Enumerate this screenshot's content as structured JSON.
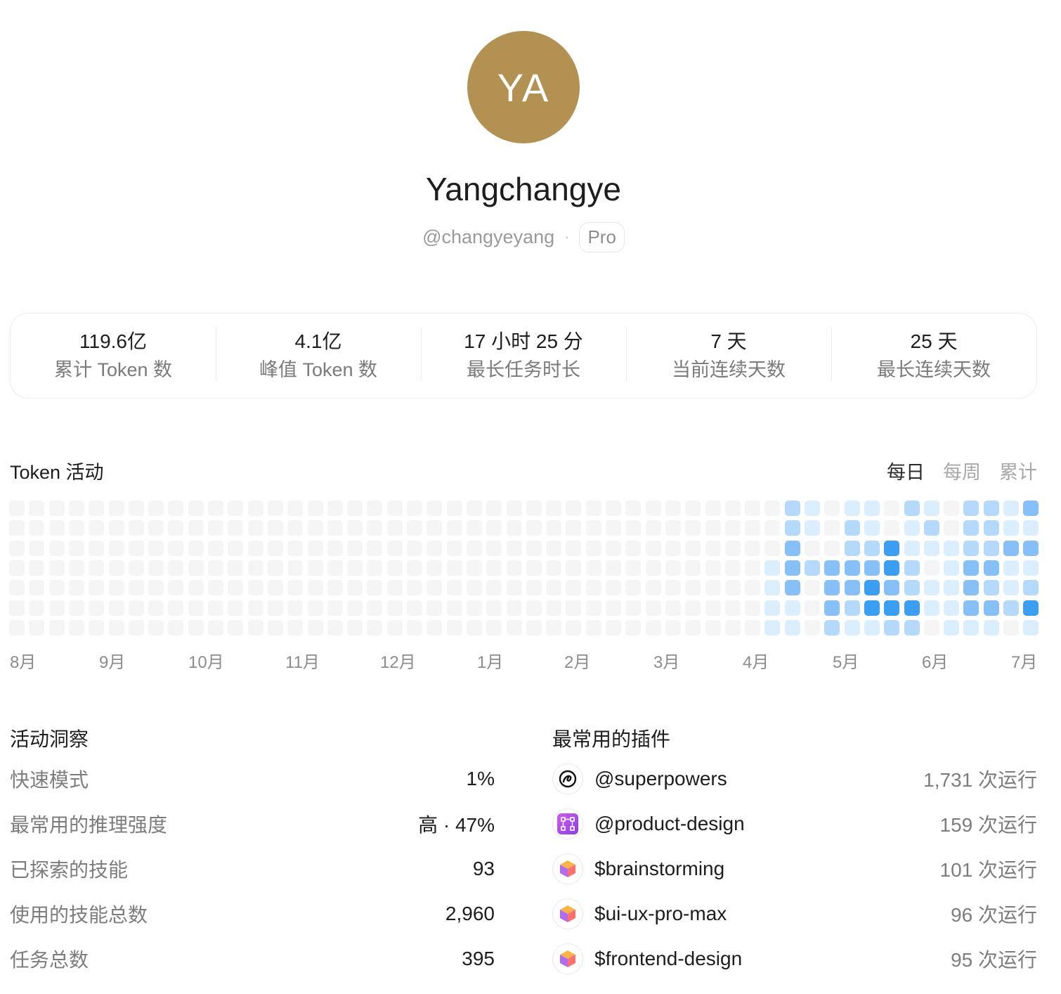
{
  "profile": {
    "initials": "YA",
    "avatar_color": "#b39153",
    "name": "Yangchangye",
    "handle": "@changyeyang",
    "separator": "·",
    "plan": "Pro"
  },
  "stats": [
    {
      "value": "119.6亿",
      "label": "累计 Token 数"
    },
    {
      "value": "4.1亿",
      "label": "峰值 Token 数"
    },
    {
      "value": "17 小时 25 分",
      "label": "最长任务时长"
    },
    {
      "value": "7 天",
      "label": "当前连续天数"
    },
    {
      "value": "25 天",
      "label": "最长连续天数"
    }
  ],
  "activity": {
    "title": "Token 活动",
    "tabs": [
      {
        "label": "每日",
        "active": true
      },
      {
        "label": "每周",
        "active": false
      },
      {
        "label": "累计",
        "active": false
      }
    ],
    "colors": [
      "#f5f5f5",
      "#dbeefd",
      "#b4d9fb",
      "#86c0f6",
      "#3b9ef0"
    ],
    "active_weeks": [
      [
        0,
        0,
        0,
        1,
        1,
        1,
        1
      ],
      [
        2,
        2,
        3,
        3,
        3,
        1,
        1
      ],
      [
        1,
        1,
        0,
        2,
        0,
        0,
        0
      ],
      [
        0,
        0,
        0,
        3,
        3,
        3,
        2
      ],
      [
        1,
        2,
        2,
        3,
        3,
        2,
        1
      ],
      [
        1,
        1,
        2,
        3,
        4,
        4,
        1
      ],
      [
        0,
        0,
        4,
        4,
        3,
        4,
        2
      ],
      [
        2,
        1,
        1,
        2,
        2,
        4,
        2
      ],
      [
        1,
        2,
        1,
        0,
        1,
        1,
        0
      ],
      [
        0,
        0,
        1,
        1,
        1,
        1,
        1
      ],
      [
        2,
        2,
        2,
        3,
        3,
        3,
        1
      ],
      [
        2,
        2,
        2,
        3,
        2,
        3,
        1
      ],
      [
        1,
        1,
        3,
        1,
        1,
        2,
        0
      ],
      [
        3,
        1,
        3,
        1,
        2,
        4,
        1
      ]
    ],
    "months": [
      "8月",
      "9月",
      "10月",
      "11月",
      "12月",
      "1月",
      "2月",
      "3月",
      "4月",
      "5月",
      "6月",
      "7月"
    ]
  },
  "insights": {
    "title": "活动洞察",
    "rows": [
      {
        "label": "快速模式",
        "value": "1%"
      },
      {
        "label": "最常用的推理强度",
        "value": "高 · 47%"
      },
      {
        "label": "已探索的技能",
        "value": "93"
      },
      {
        "label": "使用的技能总数",
        "value": "2,960"
      },
      {
        "label": "任务总数",
        "value": "395"
      }
    ]
  },
  "plugins": {
    "title": "最常用的插件",
    "rows": [
      {
        "icon": "superpowers-icon",
        "name": "@superpowers",
        "count": "1,731 次运行"
      },
      {
        "icon": "product-design-icon",
        "name": "@product-design",
        "count": "159 次运行"
      },
      {
        "icon": "skill-cube-icon",
        "name": "$brainstorming",
        "count": "101 次运行"
      },
      {
        "icon": "skill-cube-icon",
        "name": "$ui-ux-pro-max",
        "count": "96 次运行"
      },
      {
        "icon": "skill-cube-icon",
        "name": "$frontend-design",
        "count": "95 次运行"
      }
    ]
  }
}
